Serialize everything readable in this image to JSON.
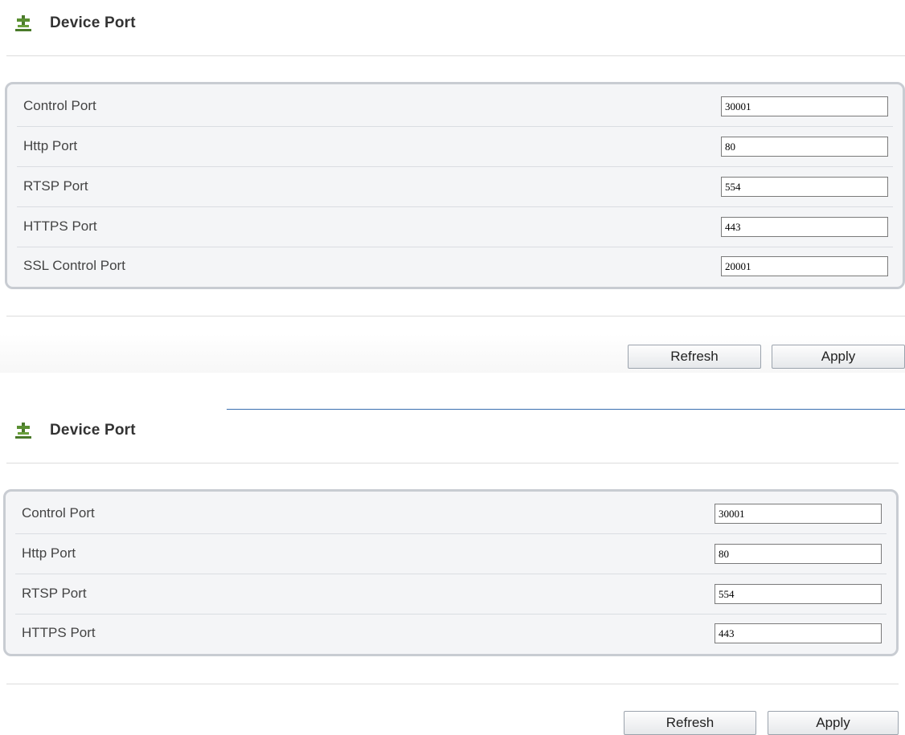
{
  "panels": [
    {
      "title": "Device Port",
      "fields": [
        {
          "label": "Control Port",
          "value": "30001"
        },
        {
          "label": "Http Port",
          "value": "80"
        },
        {
          "label": "RTSP Port",
          "value": "554"
        },
        {
          "label": "HTTPS Port",
          "value": "443"
        },
        {
          "label": "SSL Control Port",
          "value": "20001"
        }
      ],
      "refresh_label": "Refresh",
      "apply_label": "Apply"
    },
    {
      "title": "Device Port",
      "fields": [
        {
          "label": "Control Port",
          "value": "30001"
        },
        {
          "label": "Http Port",
          "value": "80"
        },
        {
          "label": "RTSP Port",
          "value": "554"
        },
        {
          "label": "HTTPS Port",
          "value": "443"
        }
      ],
      "refresh_label": "Refresh",
      "apply_label": "Apply"
    }
  ],
  "icons": {
    "title_icon": "network-port-icon"
  },
  "colors": {
    "accent_line": "#3a6fb0",
    "box_border": "#c8ccd2",
    "box_bg": "#f4f5f7"
  }
}
